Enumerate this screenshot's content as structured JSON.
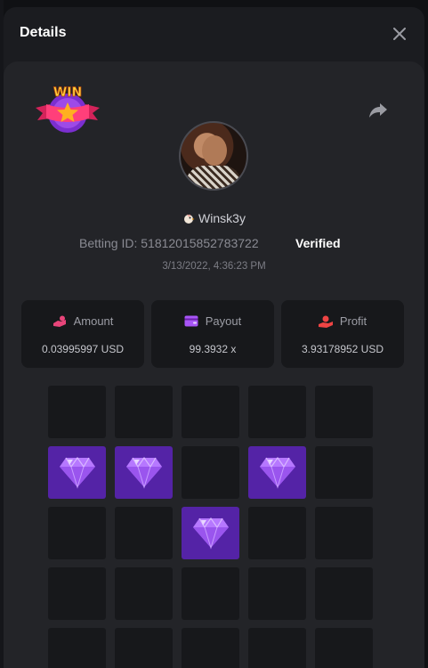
{
  "modal": {
    "title": "Details"
  },
  "user": {
    "name": "Winsk3y"
  },
  "bet": {
    "id_text": "Betting ID: 51812015852783722",
    "verified": "Verified",
    "timestamp": "3/13/2022, 4:36:23 PM"
  },
  "stats": {
    "amount": {
      "label": "Amount",
      "value": "0.03995997 USD",
      "icon": "coins-icon",
      "color": "#e8457a"
    },
    "payout": {
      "label": "Payout",
      "value": "99.3932 x",
      "icon": "wallet-icon",
      "color": "#a855f7"
    },
    "profit": {
      "label": "Profit",
      "value": "3.93178952 USD",
      "icon": "hand-coin-icon",
      "color": "#ef4444"
    }
  },
  "badge": {
    "text": "WIN",
    "icon": "win-badge-icon"
  },
  "grid": {
    "columns": 5,
    "visible_rows": 5,
    "gems": [
      [
        false,
        false,
        false,
        false,
        false
      ],
      [
        true,
        true,
        false,
        true,
        false
      ],
      [
        false,
        false,
        true,
        false,
        false
      ],
      [
        false,
        false,
        false,
        false,
        false
      ],
      [
        false,
        false,
        false,
        false,
        false
      ]
    ]
  },
  "colors": {
    "gem_tile": "#5423a6",
    "tile": "#17181b",
    "panel": "#232428"
  }
}
